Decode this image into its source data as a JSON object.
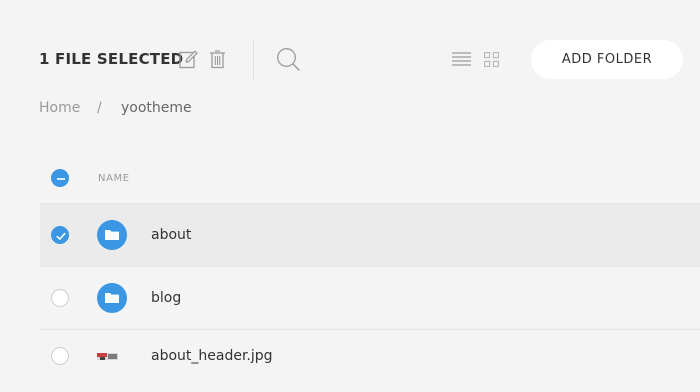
{
  "toolbar": {
    "selection_label": "1 FILE SELECTED",
    "icons": [
      "edit-icon",
      "trash-icon",
      "search-icon",
      "list-view-icon",
      "grid-view-icon"
    ],
    "add_folder_label": "ADD FOLDER"
  },
  "breadcrumb": {
    "home": "Home",
    "separator": "/",
    "current": "yootheme"
  },
  "table": {
    "header": {
      "name": "NAME",
      "select_all_state": "indeterminate"
    },
    "rows": [
      {
        "name": "about",
        "type": "folder",
        "checked": true
      },
      {
        "name": "blog",
        "type": "folder",
        "checked": false
      },
      {
        "name": "about_header.jpg",
        "type": "image",
        "checked": false
      }
    ]
  },
  "colors": {
    "accent": "#3b97e3",
    "background": "#f4f4f4",
    "selected_row": "#ebebeb"
  }
}
